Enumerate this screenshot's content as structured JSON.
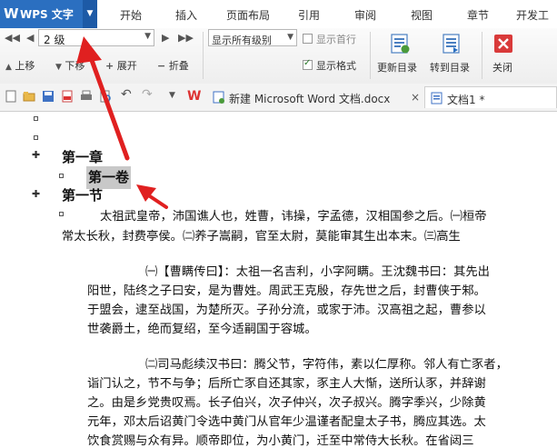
{
  "app": {
    "name": "WPS 文字"
  },
  "menu": {
    "tabs": [
      "开始",
      "插入",
      "页面布局",
      "引用",
      "审阅",
      "视图",
      "章节",
      "开发工"
    ]
  },
  "outline_toolbar": {
    "level_select_value": "2 级",
    "show_level_select_value": "显示所有级别",
    "show_first_line_label": "显示首行",
    "show_format_label": "显示格式",
    "move_up_label": "上移",
    "move_down_label": "下移",
    "expand_label": "展开",
    "collapse_label": "折叠",
    "update_toc_label": "更新目录",
    "goto_toc_label": "转到目录",
    "close_label": "关闭",
    "plus_glyph": "+",
    "minus_glyph": "−"
  },
  "doc_tabs": [
    {
      "label": "新建 Microsoft Word 文档.docx",
      "close": "×"
    },
    {
      "label": "文档1 *"
    }
  ],
  "document": {
    "headings": [
      "第一章",
      "第一卷",
      "第一节"
    ],
    "paragraphs": [
      "太祖武皇帝，沛国谯人也，姓曹，讳操，字孟德，汉相国参之后。㈠桓帝",
      "常太长秋，封费亭侯。㈡养子嵩嗣，官至太尉，莫能审其生出本末。㈢高生",
      "㈠【曹瞒传曰】：太祖一名吉利，小字阿瞒。王沈魏书曰：其先出",
      "阳世，陆终之子曰安，是为曹姓。周武王克殷，存先世之后，封曹侠于邾。",
      "于盟会，逮至战国，为楚所灭。子孙分流，或家于沛。汉高祖之起，曹参以",
      "世袭爵土，绝而复绍，至今适嗣国于容城。",
      "㈡司马彪续汉书曰：腾父节，字符伟，素以仁厚称。邻人有亡豕者，",
      "诣门认之，节不与争；后所亡豕自还其家，豕主人大惭，送所认豕，并辞谢",
      "之。由是乡党贵叹焉。长子伯兴，次子仲兴，次子叔兴。腾字季兴，少除黄",
      "元年，邓太后诏黄门令选中黄门从官年少温谨者配皇太子书，腾应其选。太",
      "饮食赏赐与众有异。顺帝即位，为小黄门，迁至中常侍大长秋。在省闼三"
    ]
  },
  "colors": {
    "brand_blue": "#2b6fc0",
    "annotation_red": "#e02020",
    "selection_gray": "#c8c8c8",
    "close_red": "#d93a3a"
  }
}
